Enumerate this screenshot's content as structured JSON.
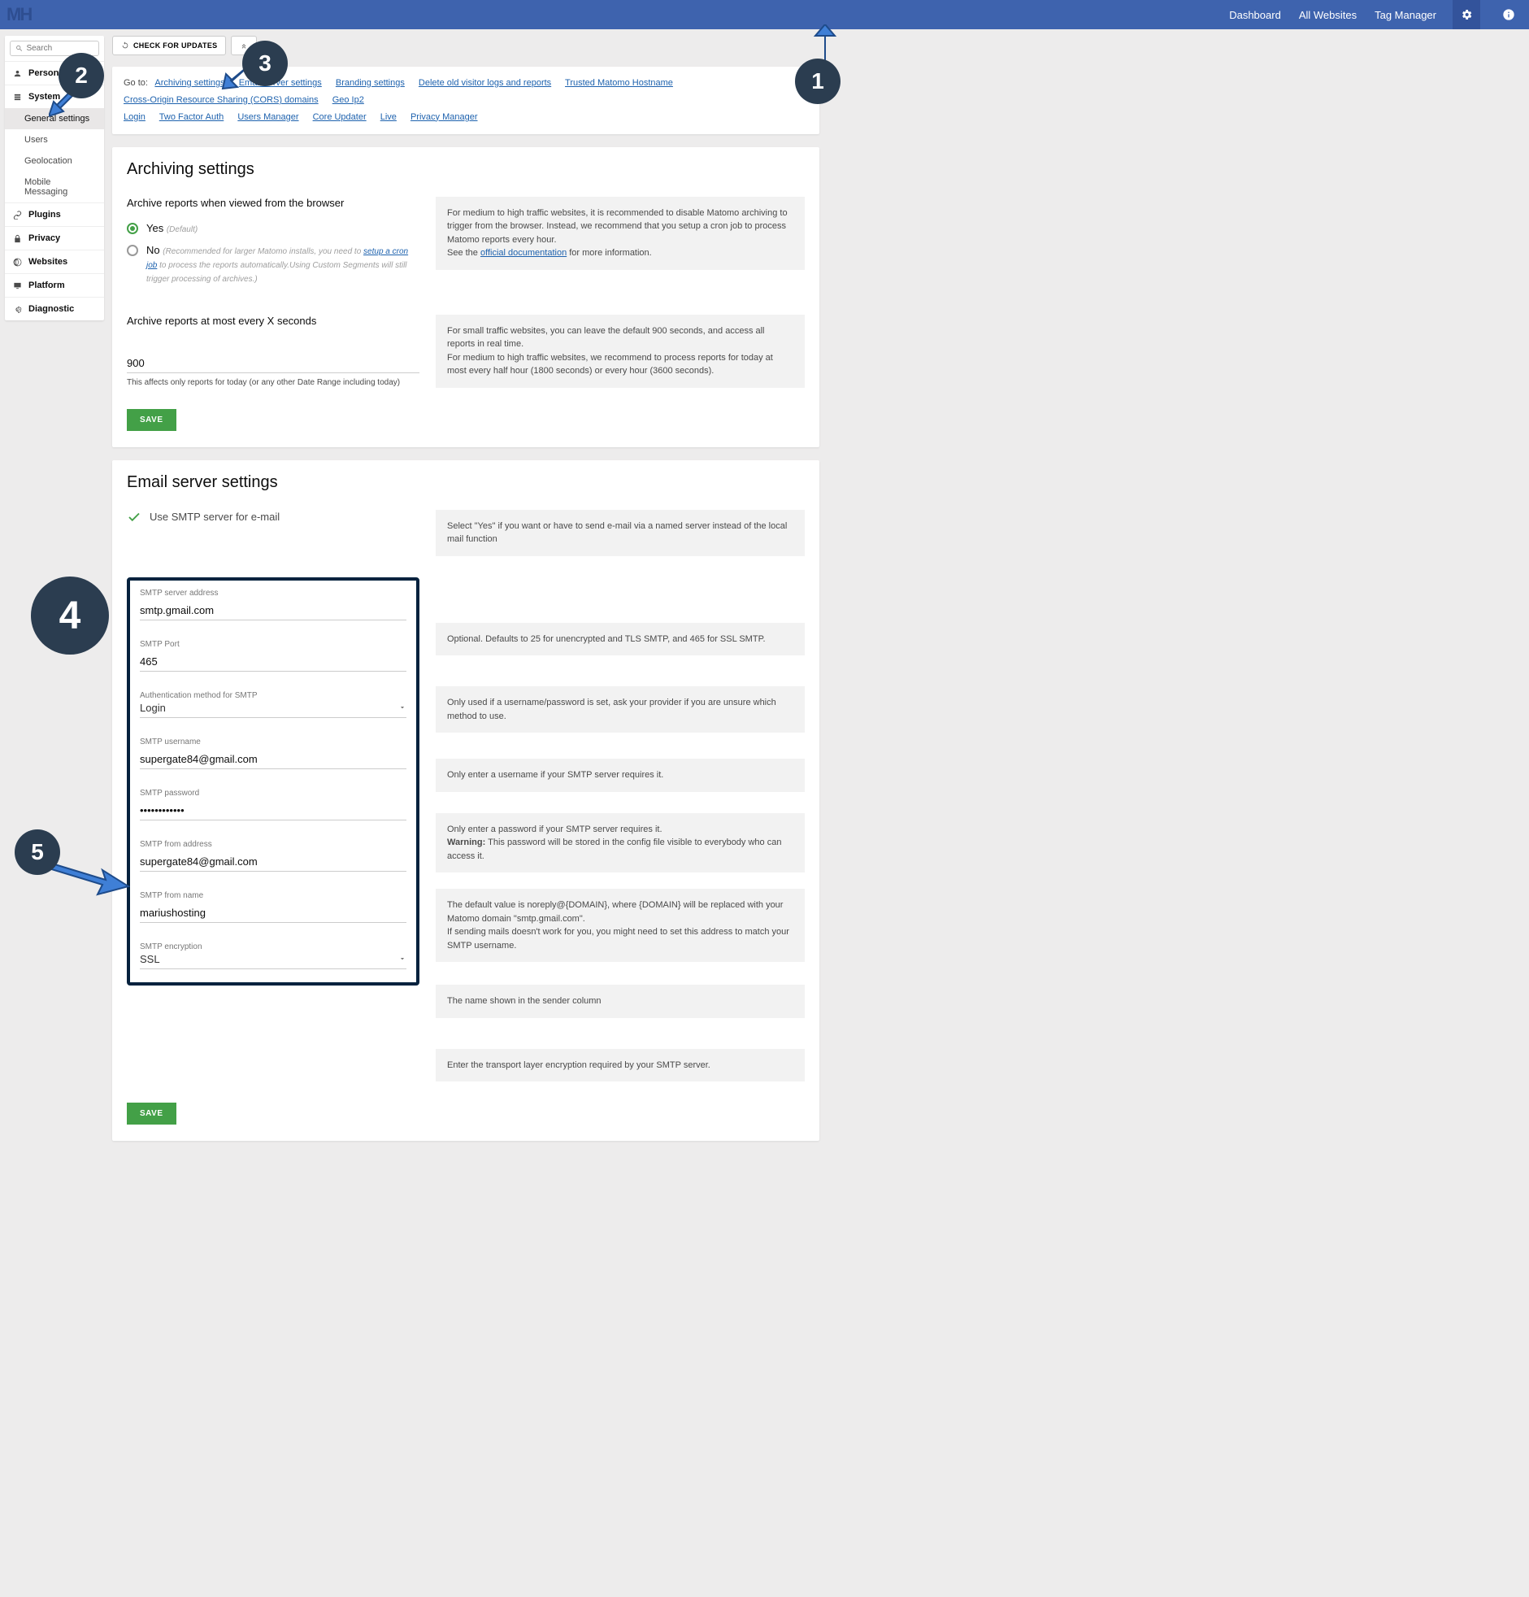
{
  "topbar": {
    "logo": "MH",
    "nav": {
      "dashboard": "Dashboard",
      "websites": "All Websites",
      "tagmgr": "Tag Manager"
    }
  },
  "search": {
    "placeholder": "Search"
  },
  "sidebar": {
    "personal": "Personal",
    "system": "System",
    "general": "General settings",
    "users": "Users",
    "geo": "Geolocation",
    "mobile": "Mobile Messaging",
    "plugins": "Plugins",
    "privacy": "Privacy",
    "websites": "Websites",
    "platform": "Platform",
    "diagnostic": "Diagnostic"
  },
  "toolbar": {
    "check": "CHECK FOR UPDATES"
  },
  "goto": {
    "label": "Go to:",
    "links": {
      "arch": "Archiving settings",
      "email": "Email server settings",
      "brand": "Branding settings",
      "del": "Delete old visitor logs and reports",
      "trusted": "Trusted Matomo Hostname",
      "cors": "Cross-Origin Resource Sharing (CORS) domains",
      "geo": "Geo Ip2",
      "login": "Login",
      "twofa": "Two Factor Auth",
      "usersmgr": "Users Manager",
      "coreup": "Core Updater",
      "live": "Live",
      "privmgr": "Privacy Manager"
    }
  },
  "archiving": {
    "title": "Archiving settings",
    "q1": "Archive reports when viewed from the browser",
    "yes": "Yes",
    "yes_sub": "(Default)",
    "no": "No",
    "no_sub_1": "(Recommended for larger Matomo installs, you need to ",
    "no_sub_link": "setup a cron job",
    "no_sub_2": " to process the reports automatically.Using Custom Segments will still trigger processing of archives.)",
    "hint1_a": "For medium to high traffic websites, it is recommended to disable Matomo archiving to trigger from the browser. Instead, we recommend that you setup a cron job to process Matomo reports every hour.",
    "hint1_b": "See the ",
    "hint1_link": "official documentation",
    "hint1_c": " for more information.",
    "q2": "Archive reports at most every X seconds",
    "seconds": "900",
    "seconds_help": "This affects only reports for today (or any other Date Range including today)",
    "hint2_a": "For small traffic websites, you can leave the default 900 seconds, and access all reports in real time.",
    "hint2_b": "For medium to high traffic websites, we recommend to process reports for today at most every half hour (1800 seconds) or every hour (3600 seconds).",
    "save": "SAVE"
  },
  "email": {
    "title": "Email server settings",
    "use_smtp": "Use SMTP server for e-mail",
    "hint_smtp": "Select \"Yes\" if you want or have to send e-mail via a named server instead of the local mail function",
    "server_lbl": "SMTP server address",
    "server": "smtp.gmail.com",
    "port_lbl": "SMTP Port",
    "port": "465",
    "port_hint": "Optional. Defaults to 25 for unencrypted and TLS SMTP, and 465 for SSL SMTP.",
    "auth_lbl": "Authentication method for SMTP",
    "auth": "Login",
    "auth_hint": "Only used if a username/password is set, ask your provider if you are unsure which method to use.",
    "user_lbl": "SMTP username",
    "user": "supergate84@gmail.com",
    "user_hint": "Only enter a username if your SMTP server requires it.",
    "pass_lbl": "SMTP password",
    "pass": "••••••••••••",
    "pass_hint_a": "Only enter a password if your SMTP server requires it.",
    "pass_hint_b": "Warning:",
    "pass_hint_c": " This password will be stored in the config file visible to everybody who can access it.",
    "from_lbl": "SMTP from address",
    "from": "supergate84@gmail.com",
    "from_hint_a": "The default value is noreply@{DOMAIN}, where {DOMAIN} will be replaced with your Matomo domain \"smtp.gmail.com\".",
    "from_hint_b": "If sending mails doesn't work for you, you might need to set this address to match your SMTP username.",
    "name_lbl": "SMTP from name",
    "name": "mariushosting",
    "name_hint": "The name shown in the sender column",
    "enc_lbl": "SMTP encryption",
    "enc": "SSL",
    "enc_hint": "Enter the transport layer encryption required by your SMTP server.",
    "save": "SAVE"
  },
  "badges": {
    "b1": "1",
    "b2": "2",
    "b3": "3",
    "b4": "4",
    "b5": "5"
  }
}
